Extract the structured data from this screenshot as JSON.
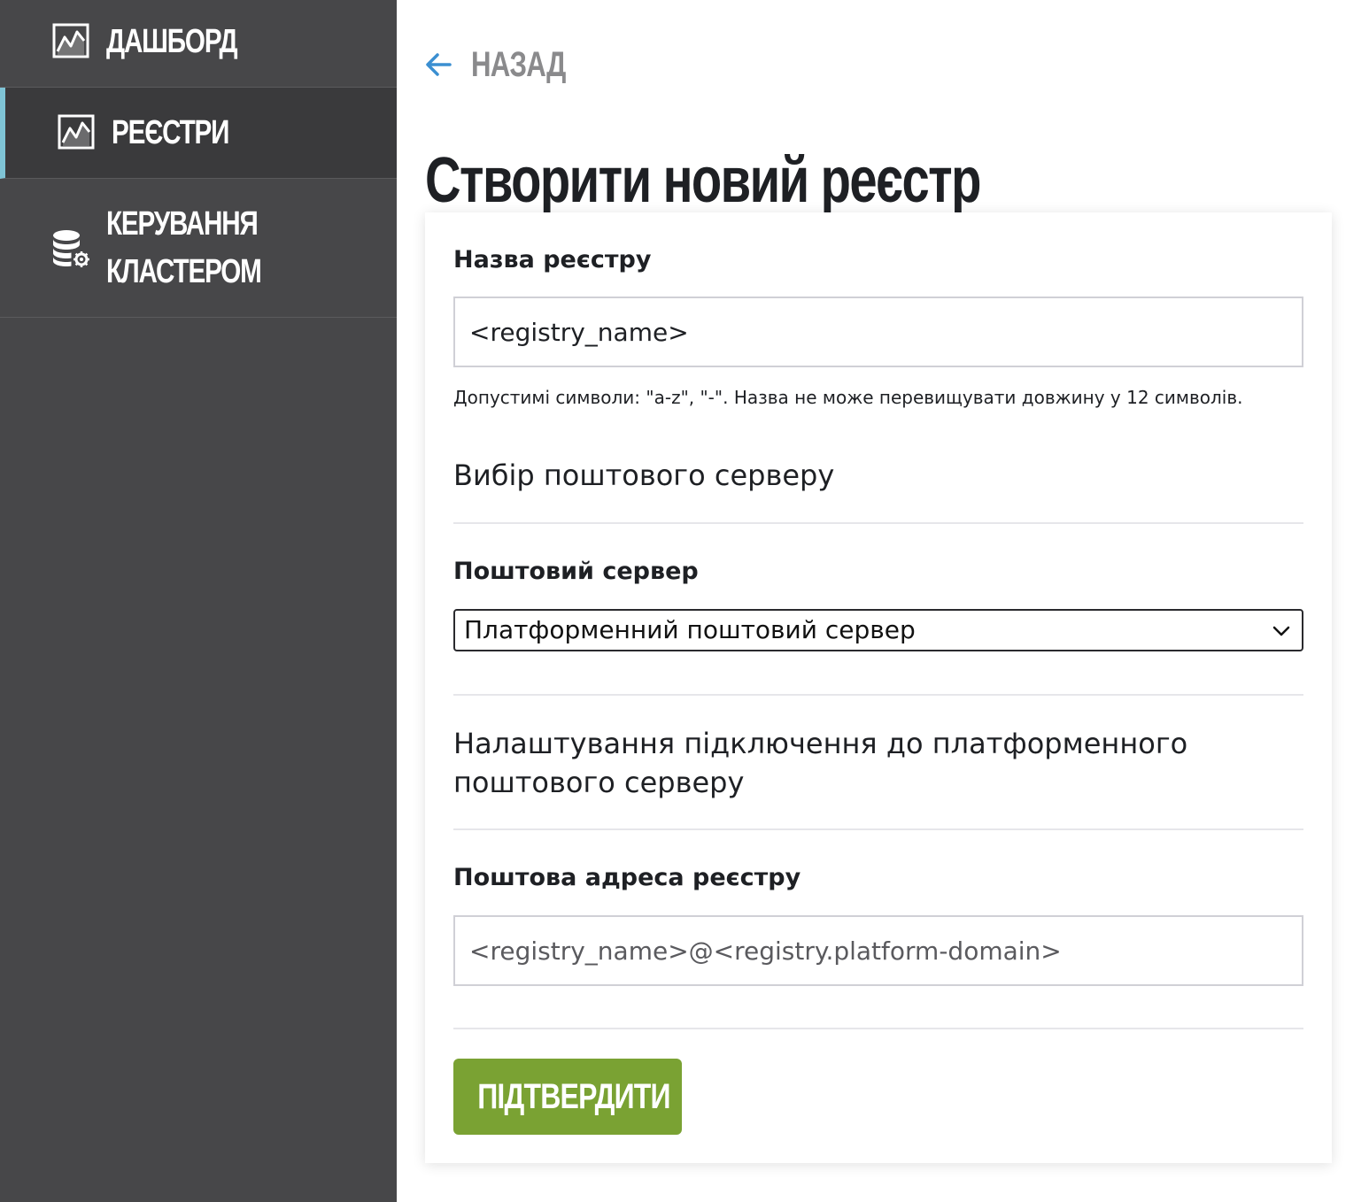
{
  "sidebar": {
    "items": [
      {
        "label": "ДАШБОРД",
        "icon": "chart-icon",
        "active": false
      },
      {
        "label": "РЕЄСТРИ",
        "icon": "chart-icon",
        "active": true
      },
      {
        "label": "КЕРУВАННЯ КЛАСТЕРОМ",
        "icon": "database-settings-icon",
        "active": false
      }
    ],
    "active_accent_color": "#7fc4d6",
    "background_color": "#474749"
  },
  "back": {
    "label": "НАЗАД",
    "icon": "arrow-left-icon",
    "icon_color": "#3b8fd1"
  },
  "page": {
    "title": "Створити новий реєстр"
  },
  "form": {
    "registry_name": {
      "label": "Назва реєстру",
      "value": "<registry_name>",
      "hint": "Допустимі символи: \"a-z\", \"-\". Назва не може перевищувати довжину у 12 символів."
    },
    "mail_server_section": {
      "title": "Вибір поштового серверу"
    },
    "mail_server": {
      "label": "Поштовий сервер",
      "selected": "Платформенний поштовий сервер"
    },
    "connection_section": {
      "title": "Налаштування підключення до платформенного поштового серверу"
    },
    "registry_email": {
      "label": "Поштова адреса реєстру",
      "value": "<registry_name>@<registry.platform-domain>"
    },
    "submit": {
      "label": "ПІДТВЕРДИТИ",
      "color": "#7aa233"
    }
  }
}
